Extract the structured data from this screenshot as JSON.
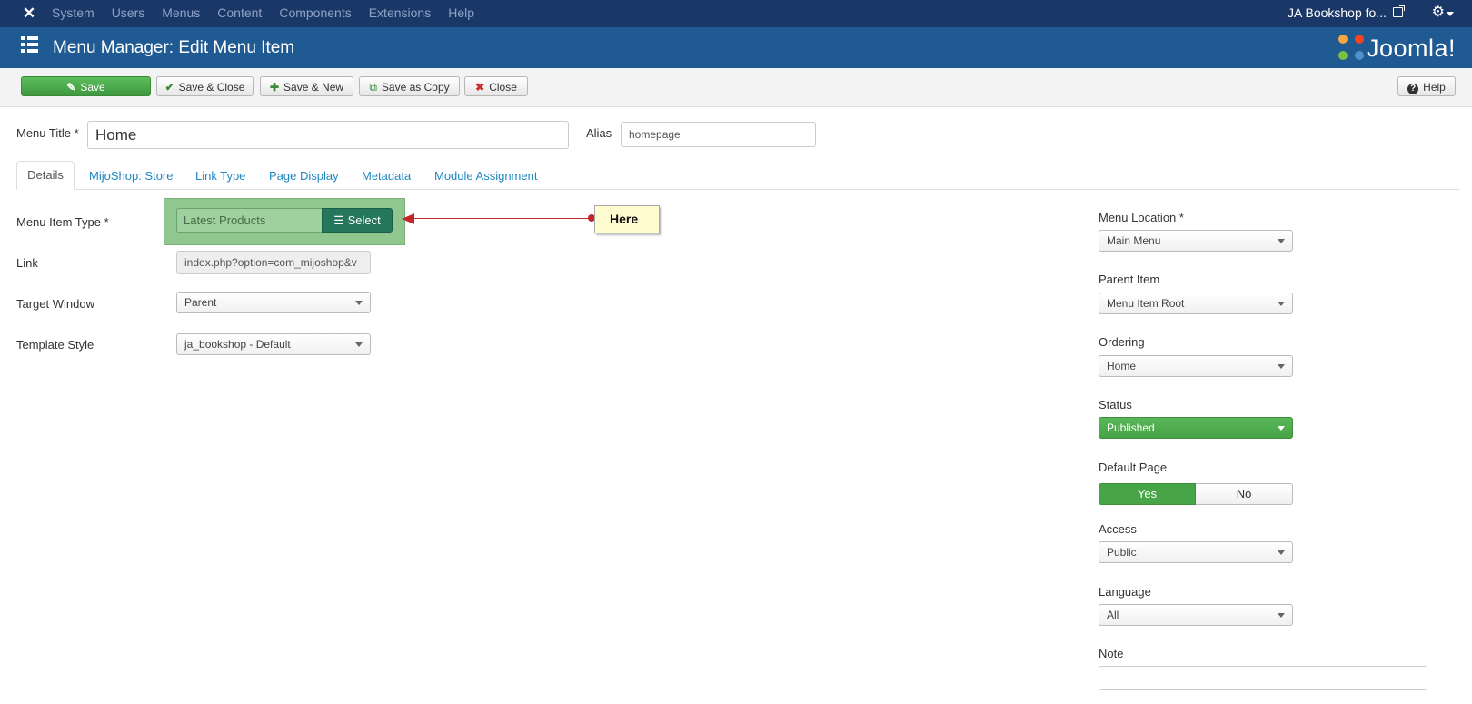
{
  "topbar": {
    "nav": [
      "System",
      "Users",
      "Menus",
      "Content",
      "Components",
      "Extensions",
      "Help"
    ],
    "site_name": "JA Bookshop fo...",
    "joomla_mark": "✕"
  },
  "header": {
    "title": "Menu Manager: Edit Menu Item",
    "logo_text": "Joomla!"
  },
  "toolbar": {
    "save": "Save",
    "save_close": "Save & Close",
    "save_new": "Save & New",
    "save_copy": "Save as Copy",
    "close": "Close",
    "help": "Help"
  },
  "form": {
    "menu_title_label": "Menu Title *",
    "menu_title_value": "Home",
    "alias_label": "Alias",
    "alias_value": "homepage"
  },
  "tabs": [
    "Details",
    "MijoShop: Store",
    "Link Type",
    "Page Display",
    "Metadata",
    "Module Assignment"
  ],
  "details": {
    "menu_item_type_label": "Menu Item Type *",
    "menu_item_type_value": "Latest Products",
    "select_button": "Select",
    "link_label": "Link",
    "link_value": "index.php?option=com_mijoshop&v",
    "target_window_label": "Target Window",
    "target_window_value": "Parent",
    "template_style_label": "Template Style",
    "template_style_value": "ja_bookshop - Default"
  },
  "callout": {
    "text": "Here"
  },
  "sidebar": {
    "menu_location_label": "Menu Location *",
    "menu_location_value": "Main Menu",
    "parent_item_label": "Parent Item",
    "parent_item_value": "Menu Item Root",
    "ordering_label": "Ordering",
    "ordering_value": "Home",
    "status_label": "Status",
    "status_value": "Published",
    "default_page_label": "Default Page",
    "default_yes": "Yes",
    "default_no": "No",
    "access_label": "Access",
    "access_value": "Public",
    "language_label": "Language",
    "language_value": "All",
    "note_label": "Note",
    "note_value": ""
  },
  "colors": {
    "topbar": "#1a3867",
    "header": "#1f5a93",
    "save_green": "#47a447",
    "select_dark_green": "#24775a",
    "callout_red": "#c0272d"
  },
  "icons": {
    "save": "✎",
    "save_close": "✔",
    "save_new": "✚",
    "save_copy": "⧉",
    "close": "✖",
    "help": "?",
    "gear": "⚙",
    "list": "☰"
  }
}
